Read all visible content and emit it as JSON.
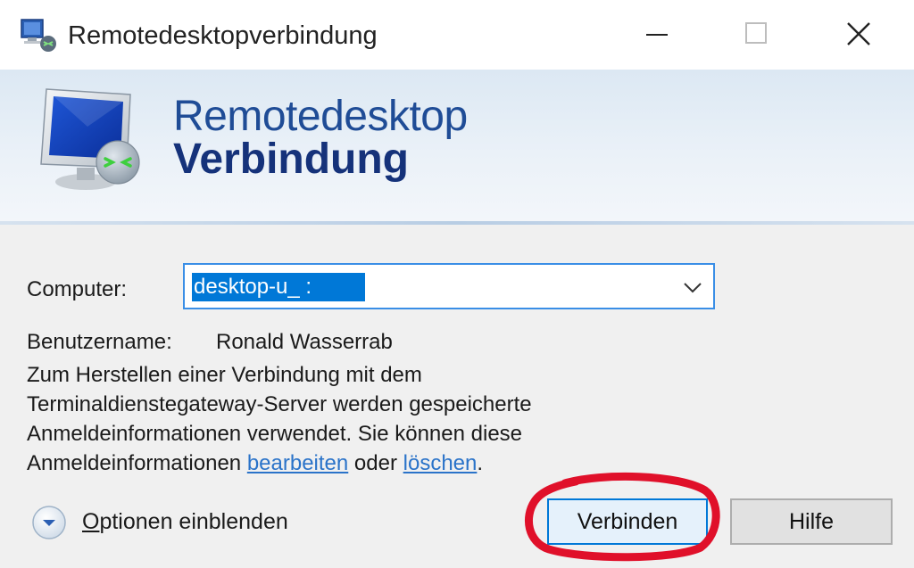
{
  "window": {
    "title": "Remotedesktopverbindung"
  },
  "banner": {
    "line1": "Remotedesktop",
    "line2": "Verbindung"
  },
  "form": {
    "computer_label": "Computer:",
    "computer_value": "desktop-u_          :",
    "user_label": "Benutzername:",
    "user_value": "Ronald Wasserrab",
    "info_text": "Zum Herstellen einer Verbindung mit dem Terminaldienstegateway-Server werden gespeicherte Anmeldeinformationen verwendet. Sie können diese Anmeldeinformationen",
    "link_edit": "bearbeiten",
    "info_mid": "oder",
    "link_delete": "löschen",
    "info_end": "."
  },
  "footer": {
    "options_label_underlined": "O",
    "options_label_rest": "ptionen einblenden",
    "connect_button": "Verbinden",
    "help_button": "Hilfe"
  },
  "colors": {
    "banner_text": "#1f4c96",
    "focus_border": "#3a8ee6",
    "selection": "#0078d7",
    "link": "#2a73c9",
    "annotation": "#e0102a"
  },
  "icons": [
    "remote-desktop-app-icon",
    "minimize-icon",
    "maximize-icon",
    "close-icon",
    "monitor-connection-icon",
    "chevron-down-icon",
    "expand-options-icon"
  ]
}
